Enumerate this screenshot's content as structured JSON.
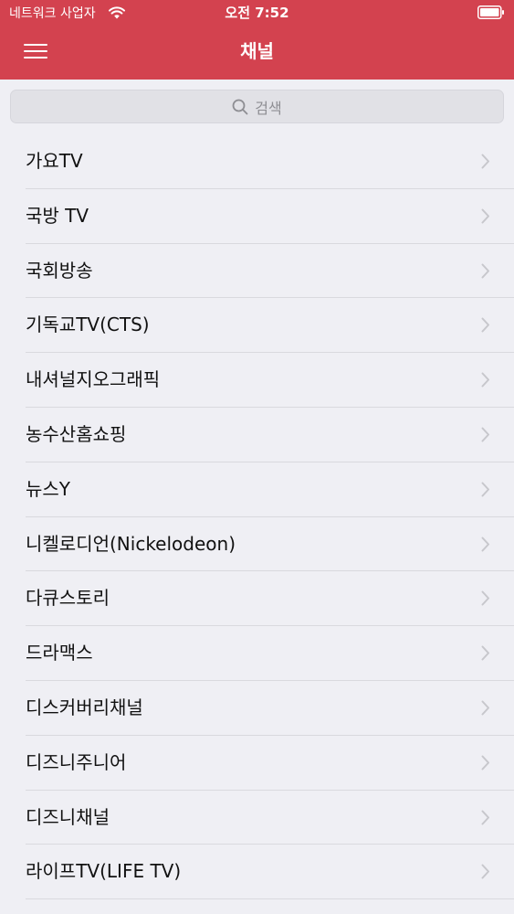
{
  "status_bar": {
    "carrier": "네트워크 사업자",
    "time": "오전 7:52"
  },
  "nav": {
    "title": "채널"
  },
  "search": {
    "placeholder": "검색"
  },
  "channels": [
    {
      "label": "가요TV"
    },
    {
      "label": "국방 TV"
    },
    {
      "label": "국회방송"
    },
    {
      "label": "기독교TV(CTS)"
    },
    {
      "label": "내셔널지오그래픽"
    },
    {
      "label": "농수산홈쇼핑"
    },
    {
      "label": "뉴스Y"
    },
    {
      "label": "니켈로디언(Nickelodeon)"
    },
    {
      "label": "다큐스토리"
    },
    {
      "label": "드라맥스"
    },
    {
      "label": "디스커버리채널"
    },
    {
      "label": "디즈니주니어"
    },
    {
      "label": "디즈니채널"
    },
    {
      "label": "라이프TV(LIFE TV)"
    }
  ],
  "colors": {
    "accent": "#d3424f",
    "background": "#efeff4",
    "chevron": "#c7c7cc"
  }
}
